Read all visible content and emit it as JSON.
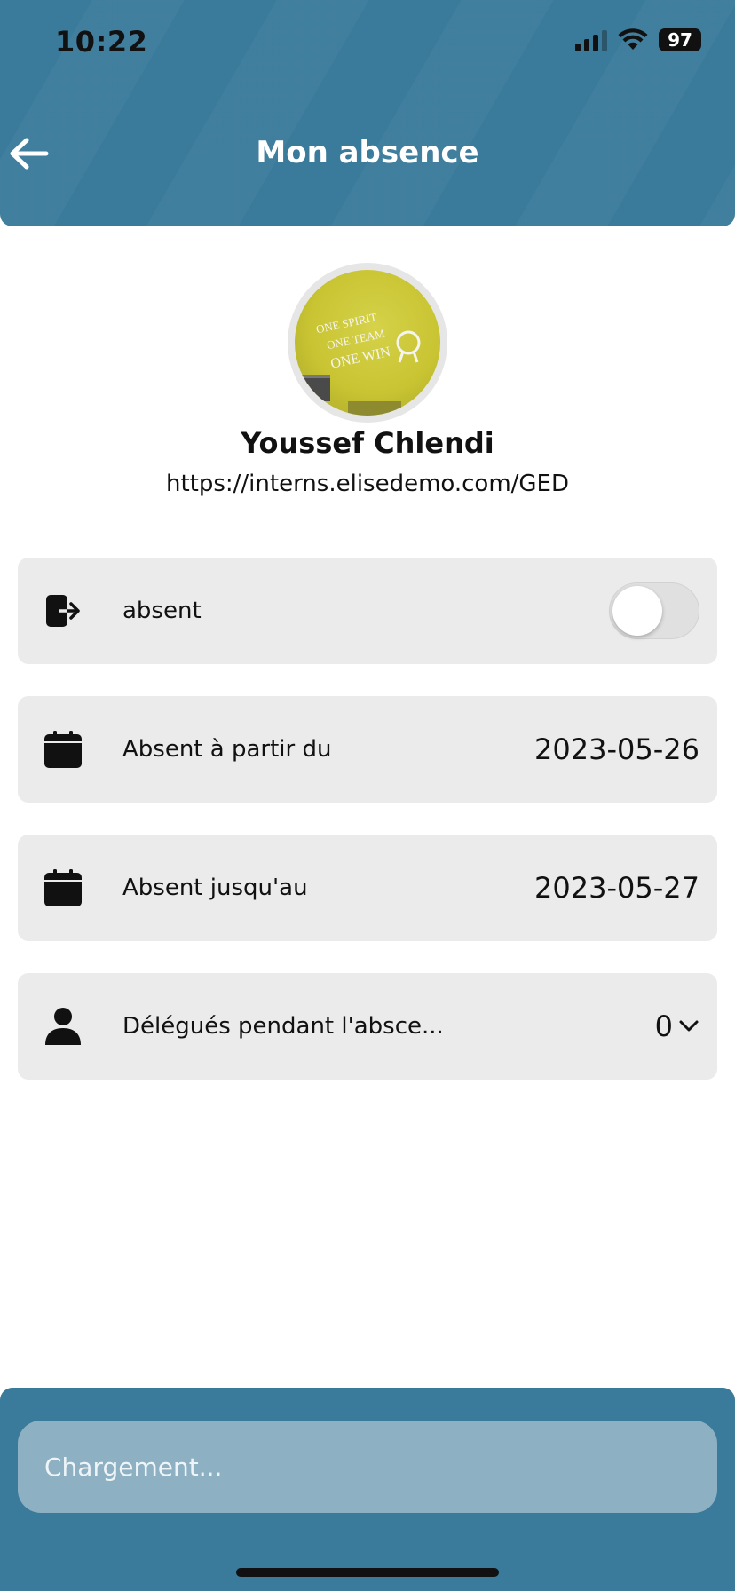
{
  "status_bar": {
    "time": "10:22",
    "battery": "97"
  },
  "header": {
    "title": "Mon absence",
    "back_icon": "arrow-left-icon"
  },
  "profile": {
    "name": "Youssef Chlendi",
    "url": "https://interns.elisedemo.com/GED",
    "avatar_text": [
      "ONE SPIRIT",
      "ONE TEAM",
      "ONE WIN"
    ]
  },
  "rows": {
    "absent": {
      "icon": "sign-out-icon",
      "label": "absent",
      "toggle_on": false
    },
    "from": {
      "icon": "calendar-icon",
      "label": "Absent à partir du",
      "value": "2023-05-26"
    },
    "until": {
      "icon": "calendar-icon",
      "label": "Absent jusqu'au",
      "value": "2023-05-27"
    },
    "delegates": {
      "icon": "person-icon",
      "label": "Délégués pendant l'absce...",
      "value": "0"
    }
  },
  "toast": {
    "message": "Chargement..."
  },
  "colors": {
    "header_bg": "#3a7a9a",
    "row_bg": "#ebebeb",
    "toast_bg": "#8db1c2"
  }
}
